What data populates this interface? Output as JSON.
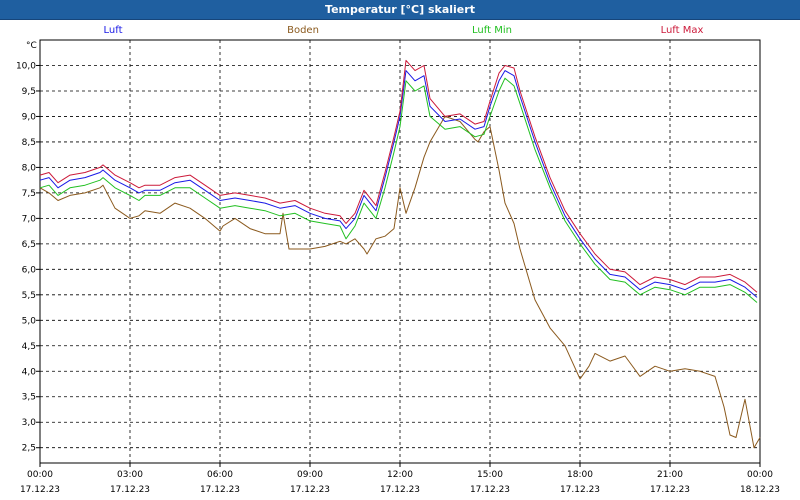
{
  "window": {
    "title": "Temperatur [°C] skaliert"
  },
  "colors": {
    "luft": "#1a1ae6",
    "boden": "#8b5a1e",
    "luft_min": "#22c022",
    "luft_max": "#cc1a3a",
    "titlebar": "#1f5fa0"
  },
  "chart_data": {
    "type": "line",
    "title": "Temperatur [°C] skaliert",
    "ylabel": "°C",
    "xlabel": "",
    "ylim": [
      2.2,
      10.5
    ],
    "yticks": [
      "2,5",
      "3,0",
      "3,5",
      "4,0",
      "4,5",
      "5,0",
      "5,5",
      "6,0",
      "6,5",
      "7,0",
      "7,5",
      "8,0",
      "8,5",
      "9,0",
      "9,5",
      "10,0"
    ],
    "ytick_values": [
      2.5,
      3.0,
      3.5,
      4.0,
      4.5,
      5.0,
      5.5,
      6.0,
      6.5,
      7.0,
      7.5,
      8.0,
      8.5,
      9.0,
      9.5,
      10.0
    ],
    "xlim_hours": [
      0,
      24
    ],
    "xticks": [
      {
        "time": "00:00",
        "date": "17.12.23"
      },
      {
        "time": "03:00",
        "date": "17.12.23"
      },
      {
        "time": "06:00",
        "date": "17.12.23"
      },
      {
        "time": "09:00",
        "date": "17.12.23"
      },
      {
        "time": "12:00",
        "date": "17.12.23"
      },
      {
        "time": "15:00",
        "date": "17.12.23"
      },
      {
        "time": "18:00",
        "date": "17.12.23"
      },
      {
        "time": "21:00",
        "date": "17.12.23"
      },
      {
        "time": "00:00",
        "date": "18.12.23"
      }
    ],
    "grid": true,
    "legend_placement": "top",
    "series": [
      {
        "name": "Luft",
        "key": "luft",
        "x": [
          0,
          0.3,
          0.6,
          1,
          1.5,
          2,
          2.1,
          2.5,
          3,
          3.3,
          3.5,
          4,
          4.5,
          5,
          5.5,
          6,
          6.5,
          7,
          7.5,
          8,
          8.5,
          9,
          9.5,
          10,
          10.2,
          10.5,
          10.8,
          11.2,
          11.5,
          11.8,
          12,
          12.2,
          12.5,
          12.8,
          13,
          13.5,
          14,
          14.5,
          14.8,
          15,
          15.3,
          15.5,
          15.8,
          16,
          16.5,
          17,
          17.5,
          18,
          18.5,
          19,
          19.5,
          20,
          20.5,
          21,
          21.5,
          22,
          22.5,
          23,
          23.5,
          23.9
        ],
        "y": [
          7.75,
          7.8,
          7.6,
          7.75,
          7.8,
          7.9,
          7.95,
          7.75,
          7.6,
          7.5,
          7.55,
          7.55,
          7.7,
          7.75,
          7.55,
          7.35,
          7.4,
          7.35,
          7.3,
          7.2,
          7.25,
          7.1,
          7.0,
          6.95,
          6.8,
          7.0,
          7.45,
          7.15,
          7.8,
          8.5,
          9.0,
          9.9,
          9.7,
          9.8,
          9.2,
          8.9,
          8.95,
          8.75,
          8.8,
          9.2,
          9.7,
          9.9,
          9.8,
          9.4,
          8.5,
          7.7,
          7.05,
          6.6,
          6.2,
          5.9,
          5.85,
          5.6,
          5.75,
          5.7,
          5.6,
          5.75,
          5.75,
          5.8,
          5.65,
          5.45
        ]
      },
      {
        "name": "Boden",
        "key": "boden",
        "x": [
          0,
          0.3,
          0.6,
          1,
          1.5,
          2,
          2.1,
          2.5,
          3,
          3.3,
          3.5,
          4,
          4.5,
          5,
          5.5,
          6,
          6.1,
          6.5,
          7,
          7.5,
          8,
          8.1,
          8.3,
          8.5,
          9,
          9.5,
          10,
          10.2,
          10.5,
          10.8,
          10.9,
          11.2,
          11.5,
          11.8,
          12,
          12.2,
          12.5,
          12.8,
          13,
          13.5,
          14,
          14.5,
          14.6,
          14.8,
          15,
          15.3,
          15.5,
          15.8,
          16,
          16.5,
          17,
          17.5,
          18,
          18.3,
          18.5,
          19,
          19.5,
          20,
          20.5,
          21,
          21.5,
          22,
          22.5,
          22.8,
          23,
          23.2,
          23.5,
          23.8,
          24
        ],
        "y": [
          7.6,
          7.5,
          7.35,
          7.45,
          7.5,
          7.6,
          7.65,
          7.2,
          7.0,
          7.05,
          7.15,
          7.1,
          7.3,
          7.2,
          7.0,
          6.75,
          6.85,
          7.0,
          6.8,
          6.7,
          6.7,
          7.1,
          6.4,
          6.4,
          6.4,
          6.45,
          6.55,
          6.5,
          6.6,
          6.4,
          6.3,
          6.6,
          6.65,
          6.8,
          7.6,
          7.1,
          7.6,
          8.2,
          8.5,
          9.0,
          8.9,
          8.55,
          8.5,
          8.7,
          8.8,
          7.95,
          7.3,
          6.9,
          6.4,
          5.4,
          4.85,
          4.5,
          3.85,
          4.1,
          4.35,
          4.2,
          4.3,
          3.9,
          4.1,
          4.0,
          4.05,
          4.0,
          3.9,
          3.3,
          2.75,
          2.7,
          3.45,
          2.5,
          2.7
        ]
      },
      {
        "name": "Luft Min",
        "key": "luft_min",
        "x": [
          0,
          0.3,
          0.6,
          1,
          1.5,
          2,
          2.1,
          2.5,
          3,
          3.3,
          3.5,
          4,
          4.5,
          5,
          5.5,
          6,
          6.5,
          7,
          7.5,
          8,
          8.5,
          9,
          9.5,
          10,
          10.2,
          10.5,
          10.8,
          11.2,
          11.5,
          11.8,
          12,
          12.2,
          12.5,
          12.8,
          13,
          13.5,
          14,
          14.5,
          14.8,
          15,
          15.3,
          15.5,
          15.8,
          16,
          16.5,
          17,
          17.5,
          18,
          18.5,
          19,
          19.5,
          20,
          20.5,
          21,
          21.5,
          22,
          22.5,
          23,
          23.5,
          23.9
        ],
        "y": [
          7.6,
          7.65,
          7.45,
          7.6,
          7.65,
          7.75,
          7.8,
          7.6,
          7.45,
          7.35,
          7.45,
          7.45,
          7.6,
          7.6,
          7.4,
          7.2,
          7.25,
          7.2,
          7.15,
          7.05,
          7.1,
          6.95,
          6.9,
          6.85,
          6.6,
          6.85,
          7.3,
          7.0,
          7.6,
          8.3,
          8.8,
          9.7,
          9.5,
          9.6,
          9.0,
          8.75,
          8.8,
          8.6,
          8.65,
          9.0,
          9.5,
          9.75,
          9.6,
          9.25,
          8.35,
          7.6,
          6.95,
          6.5,
          6.1,
          5.8,
          5.75,
          5.5,
          5.65,
          5.6,
          5.5,
          5.65,
          5.65,
          5.7,
          5.55,
          5.35
        ]
      },
      {
        "name": "Luft Max",
        "key": "luft_max",
        "x": [
          0,
          0.3,
          0.6,
          1,
          1.5,
          2,
          2.1,
          2.5,
          3,
          3.3,
          3.5,
          4,
          4.5,
          5,
          5.5,
          6,
          6.5,
          7,
          7.5,
          8,
          8.5,
          9,
          9.5,
          10,
          10.2,
          10.5,
          10.8,
          11.2,
          11.5,
          11.8,
          12,
          12.2,
          12.5,
          12.8,
          13,
          13.5,
          14,
          14.5,
          14.8,
          15,
          15.3,
          15.5,
          15.8,
          16,
          16.5,
          17,
          17.5,
          18,
          18.5,
          19,
          19.5,
          20,
          20.5,
          21,
          21.5,
          22,
          22.5,
          23,
          23.5,
          23.9
        ],
        "y": [
          7.85,
          7.9,
          7.7,
          7.85,
          7.9,
          8.0,
          8.05,
          7.85,
          7.7,
          7.6,
          7.65,
          7.65,
          7.8,
          7.85,
          7.65,
          7.45,
          7.5,
          7.45,
          7.4,
          7.3,
          7.35,
          7.2,
          7.1,
          7.05,
          6.9,
          7.1,
          7.55,
          7.25,
          7.9,
          8.6,
          9.1,
          10.1,
          9.9,
          10.0,
          9.35,
          9.0,
          9.05,
          8.85,
          8.9,
          9.3,
          9.85,
          10.0,
          9.95,
          9.5,
          8.6,
          7.8,
          7.15,
          6.7,
          6.3,
          6.0,
          5.95,
          5.7,
          5.85,
          5.8,
          5.7,
          5.85,
          5.85,
          5.9,
          5.75,
          5.55
        ]
      }
    ]
  }
}
